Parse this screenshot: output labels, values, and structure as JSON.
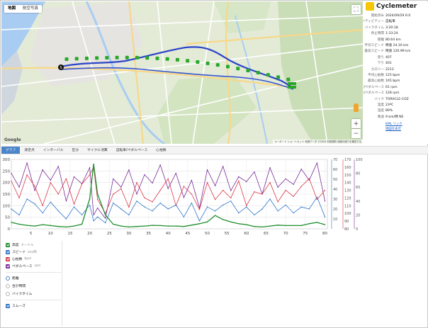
{
  "map": {
    "maptypes": [
      "地図",
      "航空写真"
    ],
    "google_label": "Google",
    "attribution": "キーボード ショートカット  地図データ ©2024  利用規約  地図の誤りを報告する",
    "start_label": "S",
    "colors": {
      "route": "#2c45c8",
      "marker": "#29a829",
      "water": "#a9cdf2",
      "land": "#e2ead6",
      "road": "#ffffff",
      "major_road": "#f7d88a"
    }
  },
  "panel": {
    "title": "Cyclemeter",
    "rows": [
      {
        "k": "開始済み",
        "v": "2024/09/29 6:0"
      },
      {
        "k": "アクティビティー",
        "v": "自転車"
      },
      {
        "k": "バイクタイム",
        "v": "3:20:18"
      },
      {
        "k": "停止時間",
        "v": "1:33:24"
      },
      {
        "k": "距離",
        "v": "80.64 km"
      },
      {
        "k": "平均スピード",
        "v": "時速 24.16 km"
      },
      {
        "k": "最高スピード",
        "v": "時速 120.99 km"
      },
      {
        "k": "登り",
        "v": "407"
      },
      {
        "k": "下り",
        "v": "401"
      },
      {
        "k": "カロリー",
        "v": "2213"
      },
      {
        "k": "平均心拍数",
        "v": "125 bpm"
      },
      {
        "k": "最高心拍数",
        "v": "165 bpm"
      },
      {
        "k": "平均ペダルペース",
        "v": "61 rpm"
      },
      {
        "k": "最高ペダルペース",
        "v": "128 rpm"
      },
      {
        "k": "バイク",
        "v": "TORACLE-COZ"
      },
      {
        "k": "温度",
        "v": "23ºC"
      },
      {
        "k": "湿度",
        "v": "89%"
      },
      {
        "k": "風速",
        "v": "9 km/時 NE"
      }
    ],
    "links": [
      "KML リンク",
      "地図を表示"
    ]
  },
  "tabs": [
    "グラフ",
    "測定点",
    "インターバル",
    "区分",
    "サイクル消費",
    "自転車/ペダルペース",
    "心拍数"
  ],
  "legend": {
    "series": [
      {
        "name": "高度",
        "unit": "メートル",
        "color": "#1f8f2e"
      },
      {
        "name": "スピード",
        "unit": "km/時",
        "color": "#2f76c9"
      },
      {
        "name": "心拍数",
        "unit": "bpm",
        "color": "#d8394a"
      },
      {
        "name": "ペダルペース",
        "unit": "rpm",
        "color": "#7a2d9a"
      }
    ],
    "xaxis_options": [
      "距離",
      "合計時間",
      "バイクタイム"
    ],
    "smooth_label": "スムーズ"
  },
  "chart_data": {
    "type": "line",
    "x": [
      0,
      2,
      4,
      6,
      8,
      10,
      12,
      14,
      16,
      18,
      20,
      21,
      22,
      24,
      26,
      28,
      30,
      32,
      34,
      36,
      38,
      40,
      42,
      44,
      46,
      48,
      50,
      52,
      54,
      56,
      58,
      60,
      62,
      64,
      66,
      68,
      70,
      72,
      74,
      76,
      78,
      80
    ],
    "xticks": [
      5,
      10,
      15,
      20,
      25,
      30,
      35,
      40,
      45,
      50,
      55,
      60,
      65,
      70,
      75,
      80
    ],
    "xlim": [
      0,
      80.64
    ],
    "left_axis": {
      "ticks": [
        0,
        50,
        100,
        150,
        200,
        250,
        300
      ],
      "ylim": [
        0,
        300
      ]
    },
    "right_axes": [
      {
        "ticks": [
          10,
          20,
          30,
          40,
          50,
          60,
          70
        ],
        "ylim": [
          0,
          70
        ]
      },
      {
        "ticks": [
          80,
          90,
          100,
          110,
          120,
          130,
          140,
          150,
          160,
          170
        ],
        "ylim": [
          80,
          170
        ]
      },
      {
        "ticks": [
          0,
          20,
          40,
          60,
          80,
          100
        ],
        "ylim": [
          0,
          100
        ]
      }
    ],
    "grid": true,
    "series": [
      {
        "name": "高度",
        "axis": "left",
        "color": "#1f8f2e",
        "values": [
          28,
          20,
          15,
          12,
          18,
          14,
          10,
          8,
          12,
          20,
          130,
          280,
          150,
          60,
          20,
          12,
          8,
          10,
          12,
          15,
          14,
          12,
          12,
          10,
          16,
          22,
          30,
          58,
          40,
          30,
          22,
          18,
          10,
          8,
          12,
          16,
          14,
          14,
          14,
          22,
          28,
          18
        ]
      },
      {
        "name": "スピード",
        "axis": "right1",
        "color": "#2f76c9",
        "values": [
          20,
          14,
          30,
          25,
          16,
          27,
          18,
          10,
          22,
          14,
          24,
          8,
          12,
          6,
          26,
          20,
          14,
          28,
          22,
          18,
          26,
          20,
          24,
          12,
          26,
          8,
          22,
          18,
          24,
          28,
          16,
          22,
          14,
          20,
          30,
          18,
          24,
          16,
          22,
          20,
          32,
          12
        ]
      },
      {
        "name": "心拍数",
        "axis": "right2",
        "color": "#d8394a",
        "values": [
          142,
          120,
          150,
          135,
          110,
          140,
          125,
          145,
          112,
          138,
          150,
          160,
          118,
          100,
          125,
          132,
          108,
          140,
          120,
          115,
          130,
          145,
          110,
          135,
          125,
          105,
          140,
          118,
          130,
          120,
          142,
          110,
          128,
          125,
          140,
          115,
          130,
          122,
          135,
          145,
          118,
          130
        ]
      },
      {
        "name": "ペダルペース",
        "axis": "right3",
        "color": "#7a2d9a",
        "values": [
          80,
          60,
          95,
          55,
          85,
          70,
          90,
          40,
          75,
          65,
          88,
          20,
          30,
          15,
          72,
          60,
          85,
          50,
          78,
          66,
          92,
          58,
          80,
          45,
          70,
          30,
          85,
          62,
          90,
          55,
          75,
          68,
          82,
          50,
          88,
          60,
          72,
          64,
          86,
          70,
          95,
          40
        ]
      }
    ]
  }
}
